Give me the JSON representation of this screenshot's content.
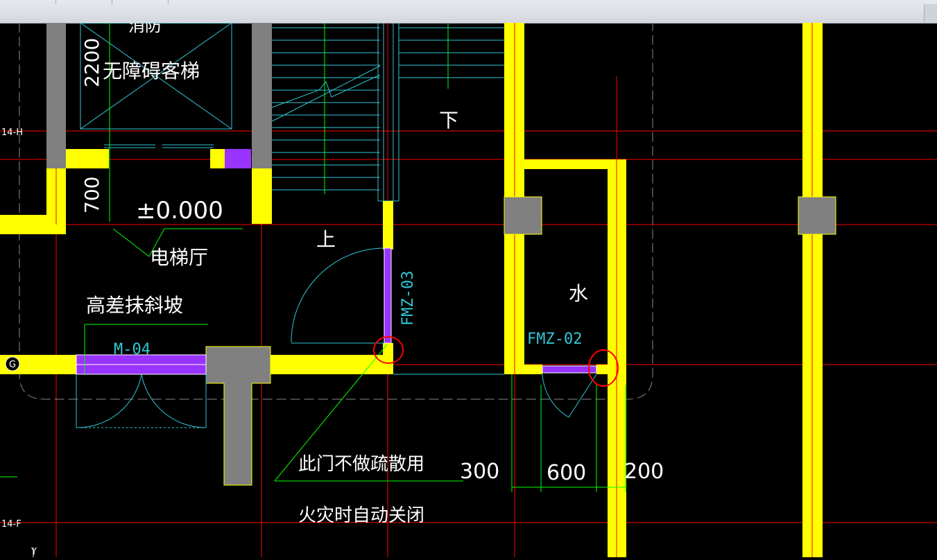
{
  "toolbar": {
    "tabs": [
      "",
      "",
      ""
    ]
  },
  "drawing": {
    "room_labels": {
      "elevator": "无障碍客梯",
      "elevator_top": "消防",
      "elevator_hall": "电梯厅",
      "slope_note": "高差抹斜坡",
      "stair_up": "上",
      "stair_down": "下",
      "water": "水"
    },
    "dimensions": {
      "elevator_depth": "2200",
      "hall_width": "700",
      "elevation": "±0.000",
      "dim_300": "300",
      "dim_600": "600",
      "dim_200": "200"
    },
    "door_tags": {
      "door_m04": "M-04",
      "door_fmz03": "FMZ-03",
      "door_fmz02": "FMZ-02"
    },
    "notes": {
      "line1": "此门不做疏散用",
      "line2": "火灾时自动关闭"
    },
    "axes": {
      "axis_h": "14-H",
      "axis_g": "G",
      "axis_f": "14-F",
      "ucs_y": "Y"
    }
  },
  "colors": {
    "wall": "#ffff00",
    "column": "#808080",
    "door": "#9933ff",
    "axis_line": "#ff0000",
    "annotation": "#00ff00",
    "cyan": "#2ec9d6",
    "highlight_circle": "#ff0000"
  }
}
